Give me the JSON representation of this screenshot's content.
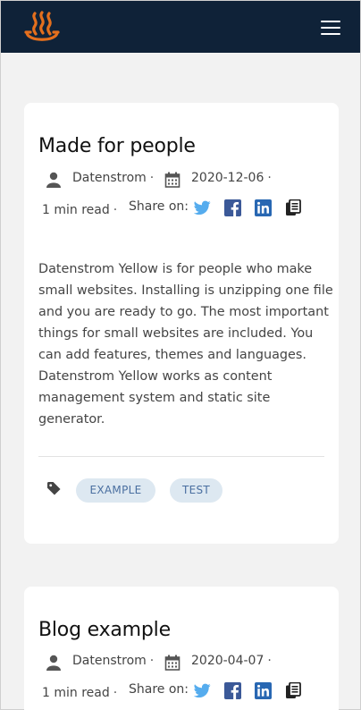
{
  "header": {
    "logo_icon": "hot-spring-logo-icon",
    "menu_icon": "hamburger-menu-icon",
    "background": "#0f2238"
  },
  "posts": [
    {
      "title": "Made for people",
      "author": "Datenstrom",
      "date": "2020-12-06",
      "read_time": "1 min read",
      "share_label": "Share on:",
      "share_icons": [
        "twitter-icon",
        "facebook-icon",
        "linkedin-icon",
        "copy-icon"
      ],
      "body": "Datenstrom Yellow is for people who make small websites. Installing is unzipping one file and you are ready to go. The most important things for small websites are included. You can add features, themes and languages. Datenstrom Yellow works as content management system and static site generator.",
      "tags": [
        "EXAMPLE",
        "TEST"
      ]
    },
    {
      "title": "Blog example",
      "author": "Datenstrom",
      "date": "2020-04-07",
      "read_time": "1 min read",
      "share_label": "Share on:",
      "share_icons": [
        "twitter-icon",
        "facebook-icon",
        "linkedin-icon",
        "copy-icon"
      ]
    }
  ],
  "separator": "·",
  "colors": {
    "twitter": "#55acee",
    "facebook": "#3b5998",
    "linkedin": "#2867b2",
    "tag_bg": "#dde8f1",
    "tag_text": "#4a6fa0"
  }
}
